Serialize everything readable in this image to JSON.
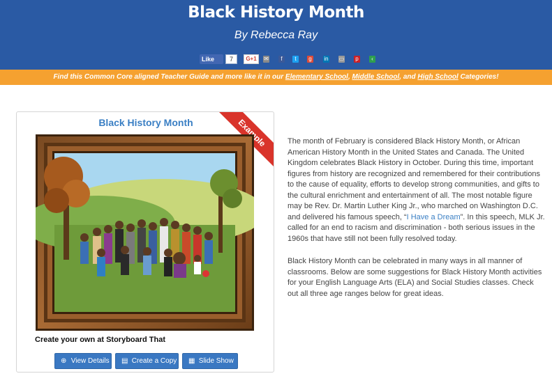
{
  "header": {
    "title": "Black History Month",
    "author": "By Rebecca Ray",
    "share": {
      "like_label": "Like",
      "like_count": "7",
      "gplus_label": "G+1"
    }
  },
  "banner": {
    "prefix": "Find this Common Core aligned Teacher Guide and more like it in our ",
    "elementary": "Elementary School",
    "sep1": ", ",
    "middle": "Middle School",
    "sep2": ", and ",
    "high": "High School",
    "suffix": " Categories!"
  },
  "card": {
    "title": "Black History Month",
    "ribbon": "Example",
    "cta": "Create your own at Storyboard That",
    "buttons": {
      "view": "View Details",
      "copy": "Create a Copy",
      "slideshow": "Slide Show"
    }
  },
  "description": {
    "p1_before": "The month of February is considered Black History Month, or African American History Month in the United States and Canada. The United Kingdom celebrates Black History in October. During this time, important figures from history are recognized and remembered for their contributions to the cause of equality, efforts to develop strong communities, and gifts to the cultural enrichment and entertainment of all. The most notable figure may be Rev. Dr. Martin Luther King Jr., who marched on Washington D.C. and delivered his famous speech, “",
    "p1_link": "I Have a Dream",
    "p1_after": "”. In this speech, MLK Jr. called for an end to racism and discrimination - both serious issues in the 1960s that have still not been fully resolved today.",
    "p2": "Black History Month can be celebrated in many ways in all manner of classrooms. Below are some suggestions for Black History Month activities for your English Language Arts (ELA) and Social Studies classes. Check out all three age ranges below for great ideas."
  },
  "colors": {
    "header_bg": "#2a5aa4",
    "banner_bg": "#f5a130",
    "button_bg": "#3a78c2",
    "ribbon": "#d9342b",
    "link": "#3a7fc4"
  }
}
